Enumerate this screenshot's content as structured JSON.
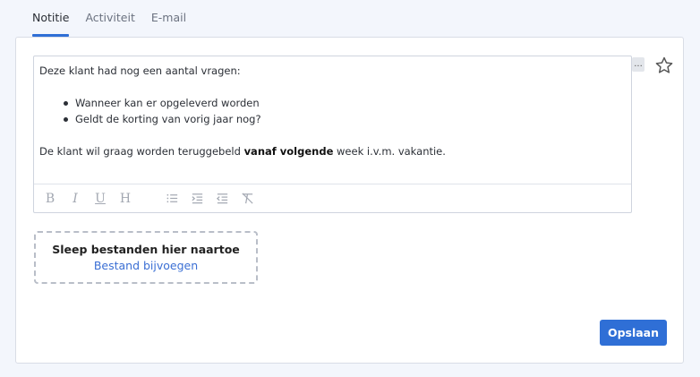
{
  "tabs": [
    {
      "label": "Notitie",
      "active": true
    },
    {
      "label": "Activiteit",
      "active": false
    },
    {
      "label": "E-mail",
      "active": false
    }
  ],
  "editor": {
    "intro": "Deze klant had nog een aantal vragen:",
    "bullets": [
      "Wanneer kan er opgeleverd worden",
      "Geldt de korting van vorig jaar nog?"
    ],
    "closing_before": "De klant wil graag worden teruggebeld ",
    "closing_bold": "vanaf volgende",
    "closing_after": " week i.v.m. vakantie.",
    "more_label": "...",
    "toolbar": {
      "bold": "B",
      "italic": "I",
      "underline": "U",
      "heading": "H",
      "icons": [
        "bulleted-list-icon",
        "indent-icon",
        "outdent-icon",
        "clear-format-icon"
      ]
    }
  },
  "favorite_icon": "star-icon",
  "dropzone": {
    "title": "Sleep bestanden hier naartoe",
    "link": "Bestand bijvoegen"
  },
  "save_label": "Opslaan",
  "colors": {
    "accent": "#2f6fd6",
    "link": "#3b6fd4",
    "background": "#f3f6fc"
  }
}
